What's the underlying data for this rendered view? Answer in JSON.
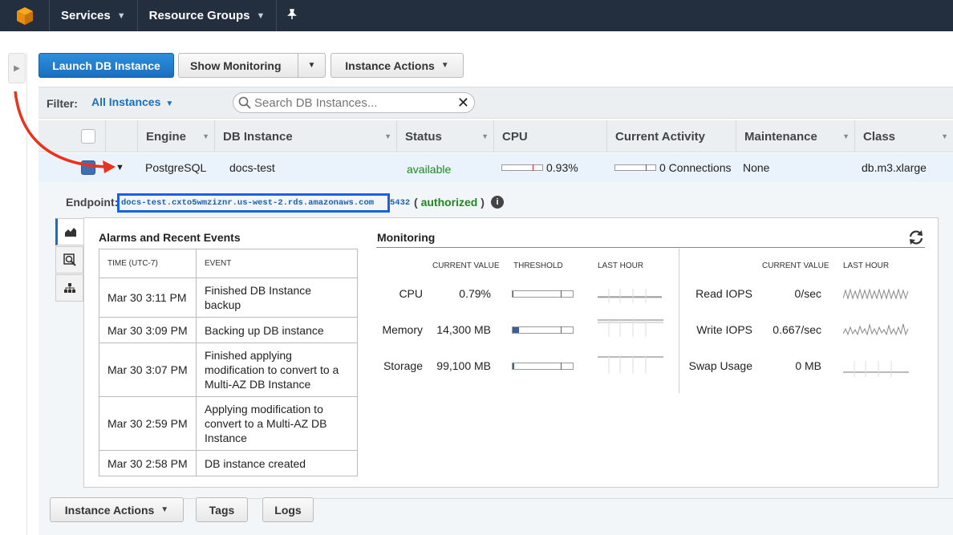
{
  "topbar": {
    "logo_icon": "aws-cube-icon",
    "services": "Services",
    "resource_groups": "Resource Groups",
    "pin_icon": "pin-icon"
  },
  "toolbar": {
    "launch": "Launch DB Instance",
    "show_monitoring": "Show Monitoring",
    "instance_actions": "Instance Actions"
  },
  "filter": {
    "label": "Filter:",
    "value": "All Instances",
    "search_placeholder": "Search DB Instances..."
  },
  "columns": [
    "Engine",
    "DB Instance",
    "Status",
    "CPU",
    "Current Activity",
    "Maintenance",
    "Class"
  ],
  "row": {
    "engine": "PostgreSQL",
    "db_instance": "docs-test",
    "status": "available",
    "cpu": "0.93%",
    "cpu_fraction": 0.93,
    "activity": "0 Connections",
    "maintenance": "None",
    "class": "db.m3.xlarge"
  },
  "endpoint": {
    "label": "Endpoint:",
    "host": "docs-test.cxto5wmziznr.us-west-2.rds.amazonaws.com",
    "port": "5432",
    "auth_open": "(",
    "auth": "authorized",
    "auth_close": ")"
  },
  "events": {
    "title": "Alarms and Recent Events",
    "col_time": "TIME (UTC-7)",
    "col_event": "EVENT",
    "rows": [
      {
        "time": "Mar 30 3:11 PM",
        "event": "Finished DB Instance backup"
      },
      {
        "time": "Mar 30 3:09 PM",
        "event": "Backing up DB instance"
      },
      {
        "time": "Mar 30 3:07 PM",
        "event": "Finished applying modification to convert to a Multi-AZ DB Instance"
      },
      {
        "time": "Mar 30 2:59 PM",
        "event": "Applying modification to convert to a Multi-AZ DB Instance"
      },
      {
        "time": "Mar 30 2:58 PM",
        "event": "DB instance created"
      }
    ]
  },
  "monitoring": {
    "title": "Monitoring",
    "h_current": "CURRENT VALUE",
    "h_threshold": "THRESHOLD",
    "h_last_hour": "LAST HOUR",
    "left": [
      {
        "label": "CPU",
        "value": "0.79%",
        "fill_percent": 1
      },
      {
        "label": "Memory",
        "value": "14,300 MB",
        "fill_percent": 10
      },
      {
        "label": "Storage",
        "value": "99,100 MB",
        "fill_percent": 2
      }
    ],
    "right": [
      {
        "label": "Read IOPS",
        "value": "0/sec"
      },
      {
        "label": "Write IOPS",
        "value": "0.667/sec"
      },
      {
        "label": "Swap Usage",
        "value": "0 MB"
      }
    ]
  },
  "bottom": {
    "instance_actions": "Instance Actions",
    "tags": "Tags",
    "logs": "Logs"
  }
}
